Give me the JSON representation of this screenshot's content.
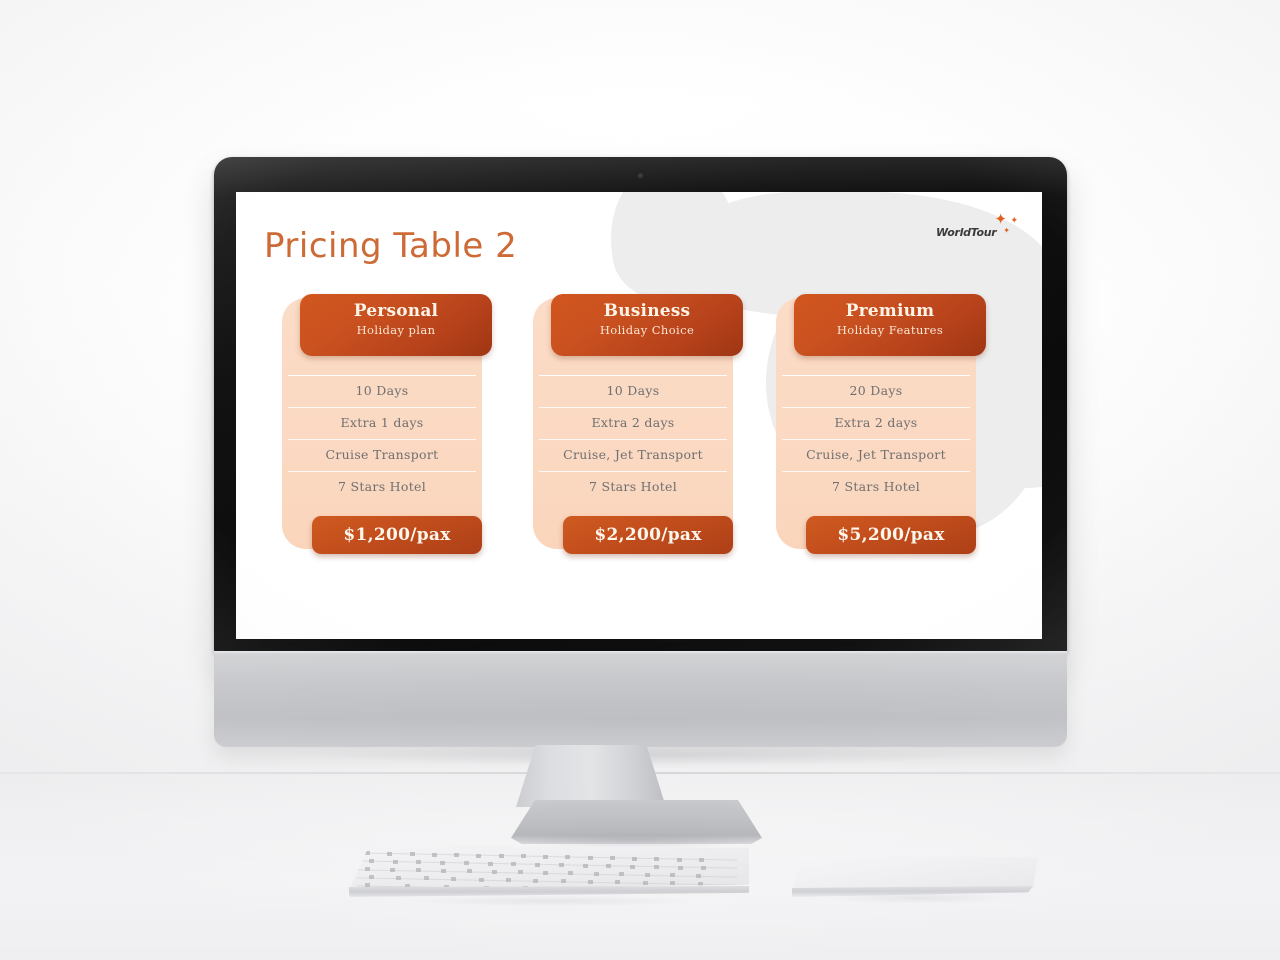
{
  "slide": {
    "title": "Pricing Table 2",
    "title_color": "#cd6a35",
    "accent_color": "#c44f1d",
    "card_body_color": "#fbd9c2",
    "background_color": "#ffffff"
  },
  "logo": {
    "word": "WorldTour",
    "sparkle_1": "✦",
    "sparkle_2": "✦",
    "sparkle_3": "✦"
  },
  "plans": [
    {
      "name": "Personal",
      "subtitle": "Holiday  plan",
      "features": [
        "10 Days",
        "Extra 1 days",
        "Cruise Transport",
        "7 Stars Hotel"
      ],
      "price": "$1,200/pax"
    },
    {
      "name": "Business",
      "subtitle": "Holiday  Choice",
      "features": [
        "10 Days",
        "Extra 2 days",
        "Cruise, Jet Transport",
        "7 Stars Hotel"
      ],
      "price": "$2,200/pax"
    },
    {
      "name": "Premium",
      "subtitle": "Holiday  Features",
      "features": [
        "20 Days",
        "Extra 2 days",
        "Cruise, Jet Transport",
        "7 Stars Hotel"
      ],
      "price": "$5,200/pax"
    }
  ]
}
